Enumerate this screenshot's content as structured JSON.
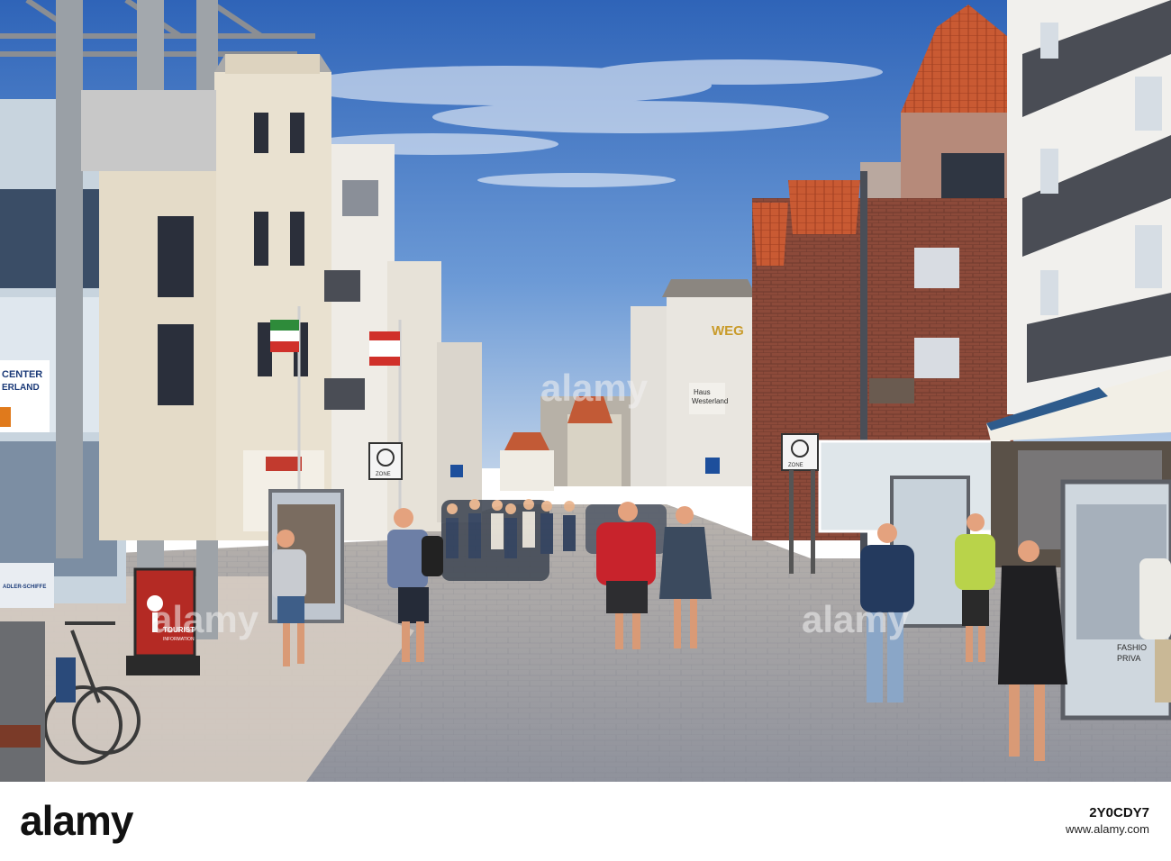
{
  "scene": {
    "signs": {
      "center_line1": "CENTER",
      "center_line2": "ERLAND",
      "adler": "ADLER-SCHIFFE",
      "tourist": "TOURIST",
      "information": "INFORMATION",
      "westerland_line1": "Haus",
      "westerland_line2": "Westerland",
      "weg": "WEG",
      "zone": "ZONE",
      "fashion": "FASHIO",
      "privat": "PRIVA"
    },
    "watermark_center": "alamy",
    "watermark_top": "alamy",
    "watermark_mid_left": "alamy",
    "watermark_mid_right": "alamy"
  },
  "footer": {
    "logo": "alamy",
    "image_id": "2Y0CDY7",
    "url": "www.alamy.com"
  },
  "colors": {
    "sky": "#3f78c8",
    "pavement": "#9a9da8",
    "roof_tiles": "#c95a33"
  }
}
